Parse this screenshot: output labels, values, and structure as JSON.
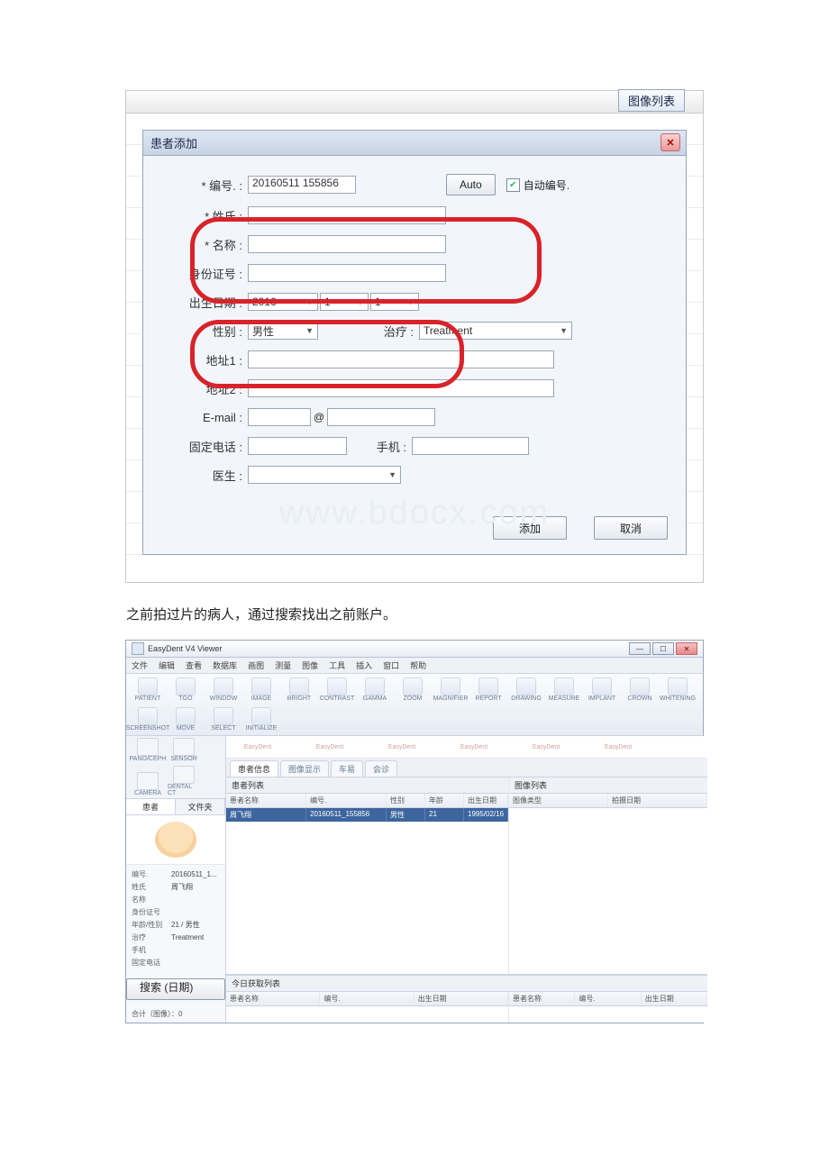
{
  "top": {
    "image_list": "图像列表",
    "dlg_title": "患者添加",
    "labels": {
      "id": "* 编号. :",
      "lastname": "* 姓氏 :",
      "firstname": "* 名称 :",
      "nid": "身份证号 :",
      "dob": "出生日期 :",
      "gender": "性别 :",
      "treat": "治疗 :",
      "addr1": "地址1 :",
      "addr2": "地址2 :",
      "email": "E-mail :",
      "tel": "固定电话 :",
      "mobile": "手机 :",
      "doctor": "医生 :"
    },
    "id_value": "20160511 155856",
    "auto_btn": "Auto",
    "auto_chk": "自动编号.",
    "dob_year": "2016",
    "dob_month": "1",
    "dob_day": "1",
    "gender_value": "男性",
    "treat_value": "Treatment",
    "at": "@",
    "add_btn": "添加",
    "cancel_btn": "取消",
    "watermark": "www.bdocx.com"
  },
  "caption": "之前拍过片的病人，通过搜索找出之前账户。",
  "app": {
    "title": "EasyDent V4 Viewer",
    "menus": [
      "文件",
      "编辑",
      "查看",
      "数据库",
      "画图",
      "测量",
      "图像",
      "工具",
      "插入",
      "窗口",
      "帮助"
    ],
    "toolbar": [
      "PATIENT",
      "TGO",
      "WINDOW",
      "IMAGE",
      "BRIGHT",
      "CONTRAST",
      "GAMMA",
      "ZOOM",
      "MAGNIFIER",
      "REPORT",
      "DRAWING",
      "MEASURE",
      "IMPLANT",
      "CROWN",
      "WHITENING",
      "SCREENSHOT",
      "MOVE",
      "SELECT",
      "INITIALIZE"
    ],
    "subbar": [
      "PANO/CEPH",
      "SENSOR",
      "CAMERA",
      "DENTAL CT"
    ],
    "lp_tabs": [
      "患者",
      "文件夹"
    ],
    "info": {
      "id_k": "编号.",
      "id_v": "20160511_1...",
      "ln_k": "姓氏",
      "ln_v": "周飞翔",
      "nm_k": "名称",
      "nm_v": "",
      "nid_k": "身份证号",
      "nid_v": "",
      "ag_k": "年龄/性别",
      "ag_v": "21 / 男性",
      "tr_k": "治疗",
      "tr_v": "Treatment",
      "mb_k": "手机",
      "mb_v": "",
      "tl_k": "固定电话",
      "tl_v": ""
    },
    "search_btn": "搜索 (日期)",
    "count": "合计（图像）：0",
    "ctabs": [
      "患者信息",
      "图像显示",
      "车易",
      "会诊"
    ],
    "thumb_label": "EasyDent",
    "listA_title": "患者列表",
    "listB_title": "图像列表",
    "listA_headers": [
      "患者名称",
      "编号.",
      "性别",
      "年龄",
      "出生日期"
    ],
    "listB_headers": [
      "图像类型",
      "拍摄日期"
    ],
    "rowA": [
      "周飞翔",
      "20160511_155856",
      "男性",
      "21",
      "1995/02/16"
    ],
    "today_title": "今日获取列表",
    "today_headers_A": [
      "患者名称",
      "编号.",
      "出生日期"
    ],
    "today_headers_B": [
      "患者名称",
      "编号.",
      "出生日期"
    ]
  }
}
